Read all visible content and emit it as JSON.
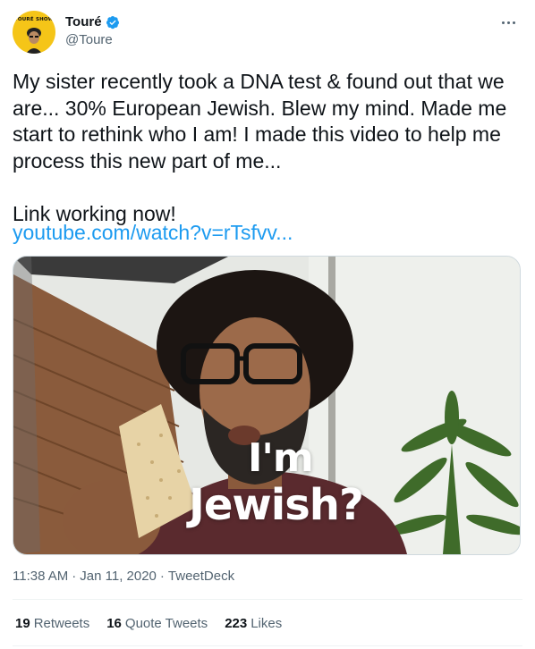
{
  "author": {
    "display_name": "Touré",
    "handle": "@Toure",
    "avatar_text": "TOURÉ SHOW",
    "verified": true
  },
  "tweet": {
    "text": "My sister recently took a DNA test & found out that we are... 30% European Jewish. Blew my mind. Made me start to rethink who I am! I made this video to help me process this new part of me...\n\nLink working now!",
    "link": "youtube.com/watch?v=rTsfvv..."
  },
  "media": {
    "caption_line1": "I'm",
    "caption_line2": "Jewish?"
  },
  "meta": {
    "time": "11:38 AM",
    "separator1": "·",
    "date": "Jan 11, 2020",
    "separator2": "·",
    "source": "TweetDeck"
  },
  "stats": {
    "retweets_count": "19",
    "retweets_label": "Retweets",
    "quotes_count": "16",
    "quotes_label": "Quote Tweets",
    "likes_count": "223",
    "likes_label": "Likes"
  },
  "colors": {
    "link": "#1d9bf0",
    "secondary": "#536471",
    "verified": "#1d9bf0",
    "avatar_bg": "#f5c518"
  }
}
